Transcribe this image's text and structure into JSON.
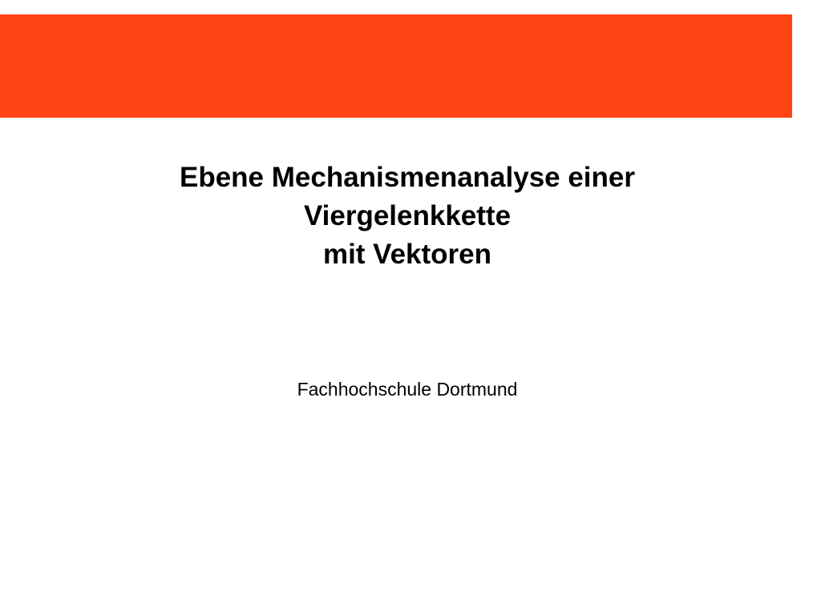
{
  "colors": {
    "banner": "#FF4513",
    "background": "#FFFFFF",
    "text": "#000000"
  },
  "slide": {
    "title_lines": [
      "Ebene Mechanismenanalyse einer",
      "Viergelenkkette",
      "mit Vektoren"
    ],
    "subtitle": "Fachhochschule Dortmund"
  }
}
